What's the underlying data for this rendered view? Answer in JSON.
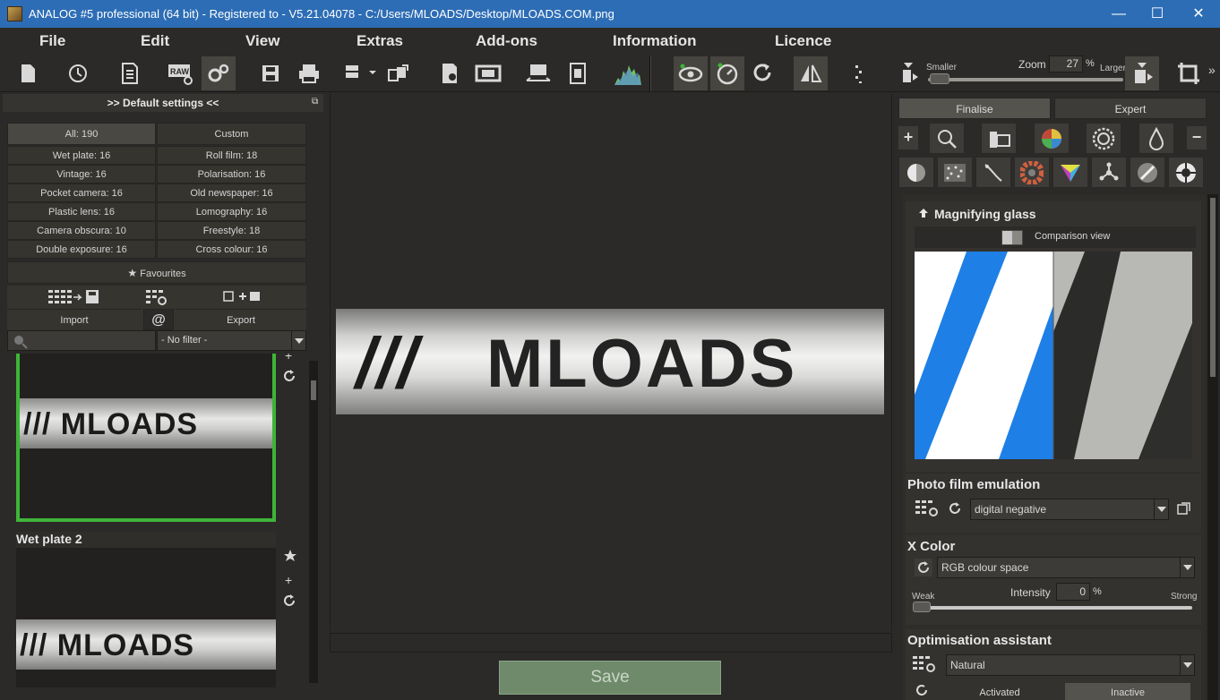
{
  "window": {
    "title": "ANALOG #5 professional (64 bit) - Registered to - V5.21.04078 - C:/Users/MLOADS/Desktop/MLOADS.COM.png",
    "minimize": "—",
    "maximize": "☐",
    "close": "✕"
  },
  "menu": [
    "File",
    "Edit",
    "View",
    "Extras",
    "Add-ons",
    "Information",
    "Licence"
  ],
  "toolbar": {
    "zoom_label": "Zoom",
    "zoom_value": "27",
    "zoom_unit": "%",
    "smaller_label": "Smaller",
    "larger_label": "Larger",
    "more": "»"
  },
  "left_panel": {
    "header": ">> Default settings <<",
    "pin": "⧉",
    "all_button": "All: 190",
    "custom_button": "Custom",
    "categories": [
      [
        "Wet plate: 16",
        "Roll film: 18"
      ],
      [
        "Vintage: 16",
        "Polarisation: 16"
      ],
      [
        "Pocket camera: 16",
        "Old newspaper: 16"
      ],
      [
        "Plastic lens: 16",
        "Lomography: 16"
      ],
      [
        "Camera obscura: 10",
        "Freestyle: 18"
      ],
      [
        "Double exposure: 16",
        "Cross colour: 16"
      ]
    ],
    "favourites": "Favourites",
    "import_label": "Import",
    "export_label": "Export",
    "at_symbol": "@",
    "filter_value": "- No filter -",
    "preset2_title": "Wet plate 2",
    "thumb_text": "/// MLOADS"
  },
  "center": {
    "image_text_slashes": "///",
    "image_text_word": "MLOADS",
    "save_button": "Save"
  },
  "right_panel": {
    "tab_finalise": "Finalise",
    "tab_expert": "Expert",
    "plus": "+",
    "minus": "−",
    "magnifier_title": "Magnifying glass",
    "comparison_view": "Comparison view",
    "photo_film_title": "Photo film emulation",
    "photo_film_value": "digital negative",
    "xcolor_title": "X Color",
    "xcolor_value": "RGB colour space",
    "intensity_label": "Intensity",
    "intensity_value": "0",
    "intensity_unit": "%",
    "weak_label": "Weak",
    "strong_label": "Strong",
    "optimisation_title": "Optimisation assistant",
    "optimisation_value": "Natural",
    "activated_label": "Activated",
    "inactive_label": "Inactive"
  },
  "colors": {
    "titlebar": "#2d6db5",
    "selection_green": "#3fb43a",
    "save_button": "#6f8a6b",
    "compare_blue": "#1e7fe6"
  }
}
